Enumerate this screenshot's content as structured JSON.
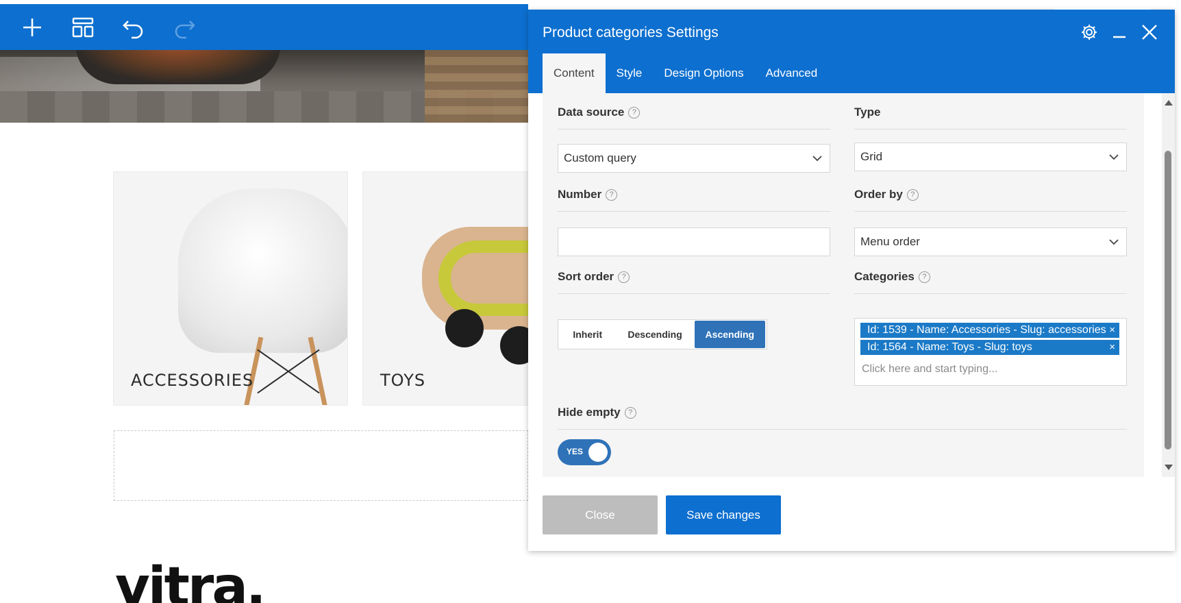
{
  "toolbar": {
    "icons": [
      "plus-icon",
      "layout-icon",
      "undo-icon",
      "redo-icon"
    ]
  },
  "page": {
    "cards": [
      {
        "label": "ACCESSORIES"
      },
      {
        "label": "TOYS"
      }
    ],
    "logo_text": "vitra."
  },
  "panel": {
    "title": "Product categories Settings",
    "tabs": [
      {
        "label": "Content",
        "active": true
      },
      {
        "label": "Style"
      },
      {
        "label": "Design Options"
      },
      {
        "label": "Advanced"
      }
    ],
    "fields": {
      "data_source": {
        "label": "Data source",
        "value": "Custom query"
      },
      "type": {
        "label": "Type",
        "value": "Grid"
      },
      "number": {
        "label": "Number",
        "value": ""
      },
      "order_by": {
        "label": "Order by",
        "value": "Menu order"
      },
      "sort_order": {
        "label": "Sort order",
        "options": [
          "Inherit",
          "Descending",
          "Ascending"
        ],
        "selected": "Ascending"
      },
      "categories": {
        "label": "Categories",
        "tags": [
          "Id: 1539 - Name: Accessories - Slug: accessories",
          "Id: 1564 - Name: Toys - Slug: toys"
        ],
        "placeholder": "Click here and start typing..."
      },
      "hide_empty": {
        "label": "Hide empty",
        "toggle_text": "YES",
        "on": true
      }
    },
    "buttons": {
      "close": "Close",
      "save": "Save changes"
    },
    "help_glyph": "?",
    "remove_glyph": "×"
  },
  "colors": {
    "brand_blue": "#0d6fcf",
    "active_blue": "#2f72b8",
    "tag_blue": "#1b7ac7",
    "disabled_gray": "#bdbdbd"
  }
}
